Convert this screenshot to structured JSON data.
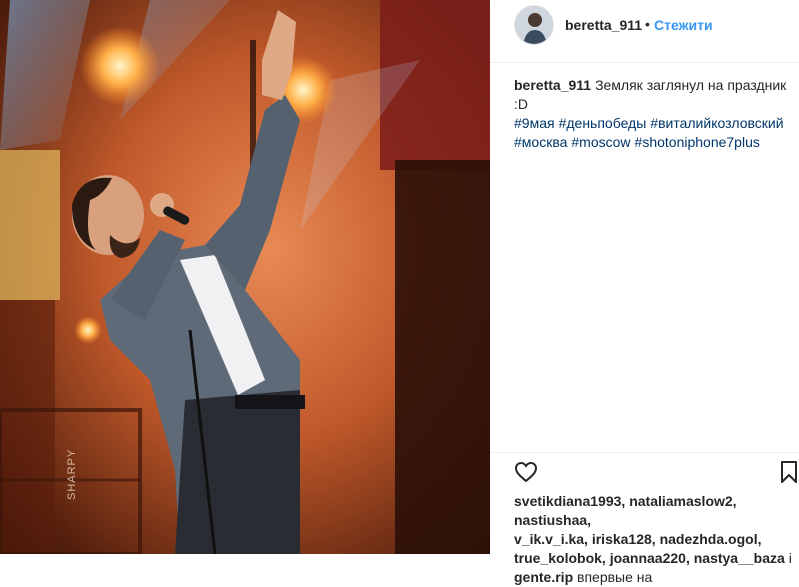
{
  "post": {
    "username": "beretta_911",
    "separator": "•",
    "follow_label": "Стежити"
  },
  "caption": {
    "username": "beretta_911",
    "text": "Земляк заглянул на праздник :D",
    "hashtags": [
      "#9мая",
      "#деньпобеды",
      "#виталийкозловский",
      "#москва",
      "#moscow",
      "#shotoniphone7plus"
    ]
  },
  "photo": {
    "stage_text": "SHARPY"
  },
  "actions": {
    "like_icon": "heart-icon",
    "save_icon": "bookmark-icon"
  },
  "likes": {
    "users": [
      "svetikdiana1993,",
      "nataliamaslow2,",
      "nastiushaa,",
      "v_ik.v_i.ka,",
      "iriska128,",
      "nadezhda.ogol,",
      "true_kolobok,",
      "joannaa220,",
      "nastya__baza",
      "i",
      "gente.rip",
      "впервые на"
    ]
  },
  "colors": {
    "link": "#003569",
    "follow": "#3897f0",
    "text": "#262626"
  }
}
